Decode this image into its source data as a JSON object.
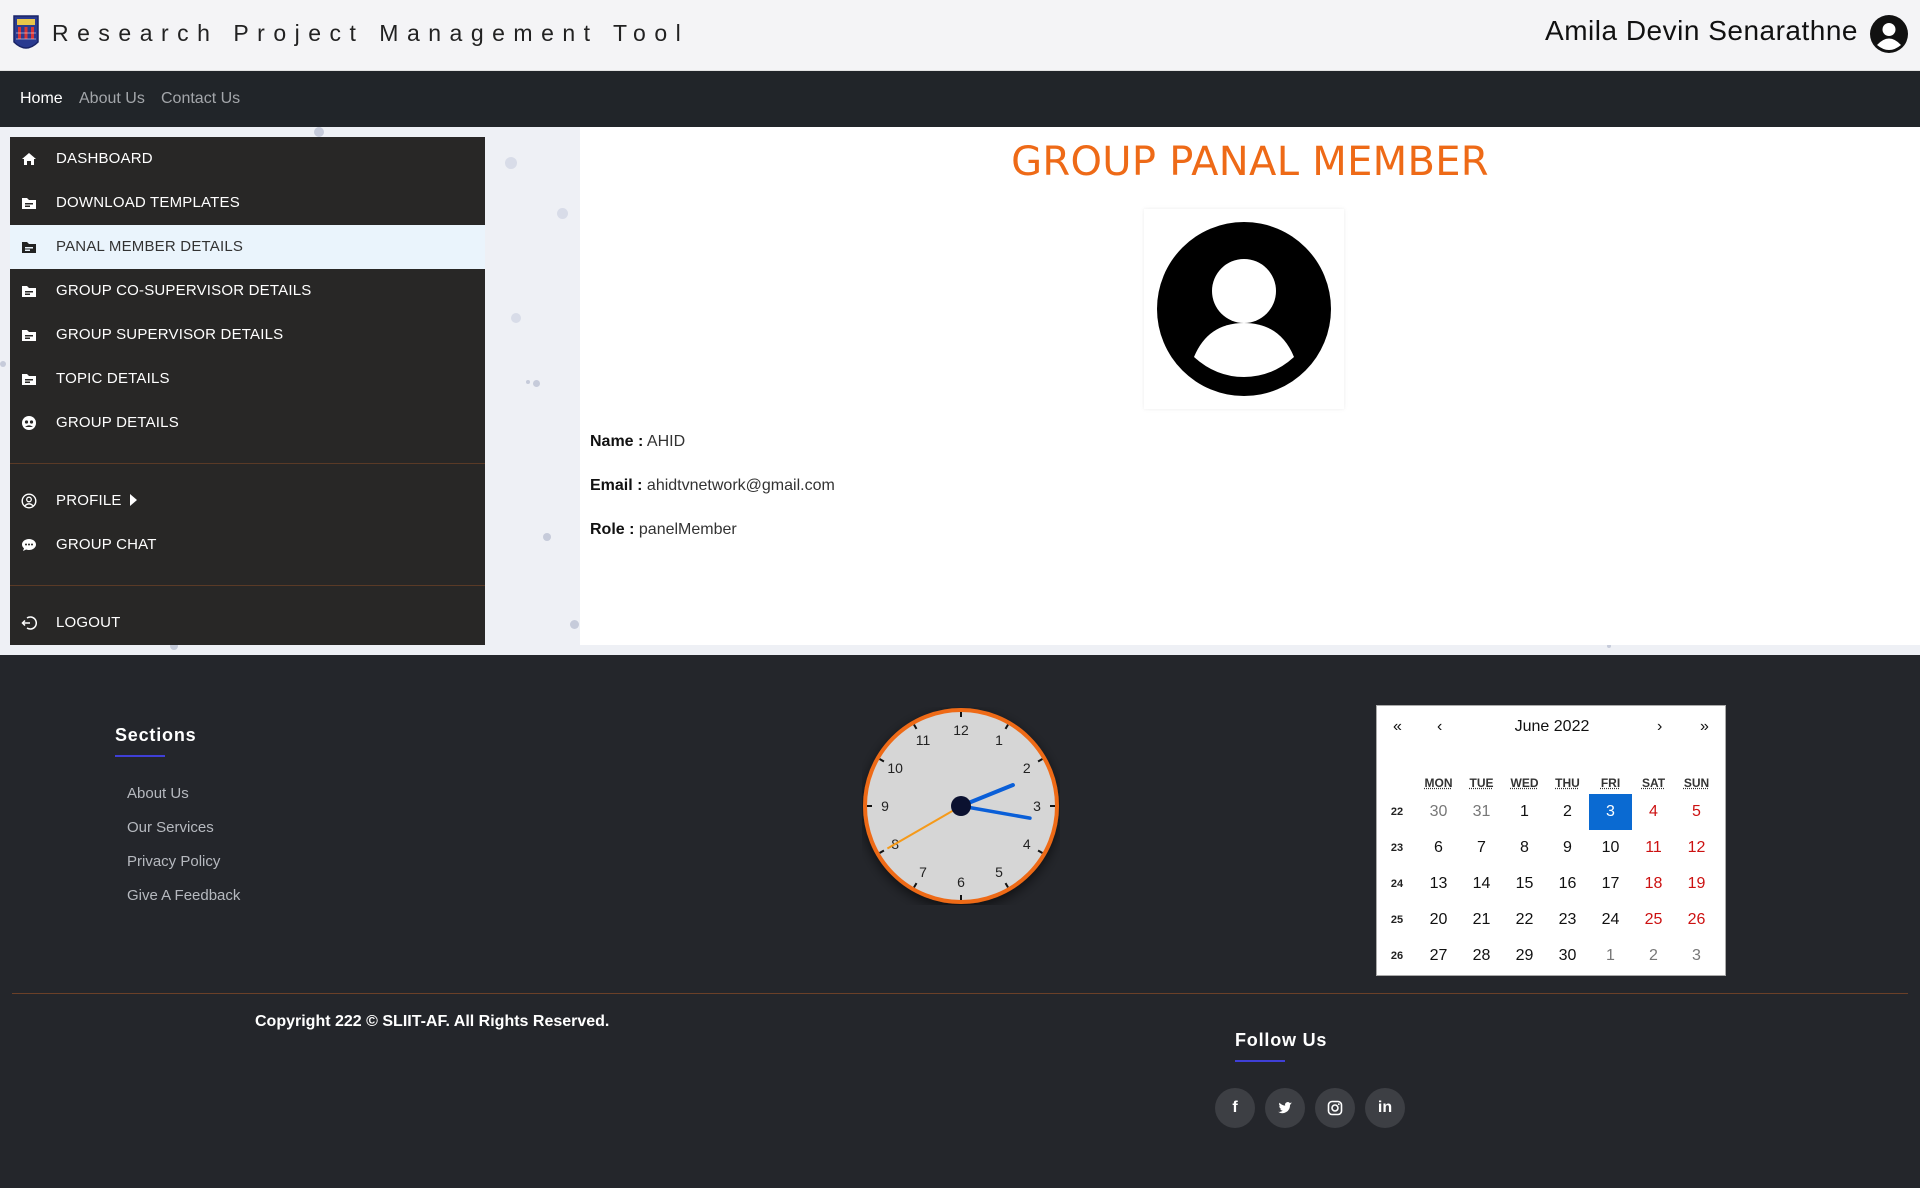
{
  "header": {
    "app_title": "Research Project Management Tool",
    "user_name": "Amila Devin Senarathne"
  },
  "nav": {
    "items": [
      {
        "label": "Home",
        "active": true
      },
      {
        "label": "About Us",
        "active": false
      },
      {
        "label": "Contact Us",
        "active": false
      }
    ]
  },
  "sidebar": {
    "items": [
      {
        "label": "DASHBOARD",
        "icon": "home-icon"
      },
      {
        "label": "DOWNLOAD TEMPLATES",
        "icon": "folder-icon"
      },
      {
        "label": "PANAL MEMBER DETAILS",
        "icon": "folder-icon",
        "active": true
      },
      {
        "label": "GROUP CO-SUPERVISOR DETAILS",
        "icon": "folder-icon"
      },
      {
        "label": "GROUP SUPERVISOR DETAILS",
        "icon": "folder-icon"
      },
      {
        "label": "TOPIC DETAILS",
        "icon": "folder-icon"
      },
      {
        "label": "GROUP DETAILS",
        "icon": "group-icon"
      },
      {
        "label": "PROFILE",
        "icon": "user-circle-icon"
      },
      {
        "label": "GROUP CHAT",
        "icon": "chat-icon"
      },
      {
        "label": "LOGOUT",
        "icon": "logout-icon"
      }
    ]
  },
  "main": {
    "title": "GROUP PANAL MEMBER",
    "fields": [
      {
        "label": "Name :",
        "value": "AHID"
      },
      {
        "label": "Email :",
        "value": "ahidtvnetwork@gmail.com"
      },
      {
        "label": "Role :",
        "value": "panelMember"
      }
    ]
  },
  "footer": {
    "sections_heading": "Sections",
    "links": [
      "About Us",
      "Our Services",
      "Privacy Policy",
      "Give A Feedback"
    ],
    "copyright": "Copyright 222 © SLIIT-AF. All Rights Reserved.",
    "follow_heading": "Follow Us",
    "social": [
      {
        "icon": "facebook-icon",
        "glyph": "f"
      },
      {
        "icon": "twitter-icon",
        "glyph": "🐦"
      },
      {
        "icon": "instagram-icon",
        "glyph": "◎"
      },
      {
        "icon": "linkedin-icon",
        "glyph": "in"
      }
    ]
  },
  "clock": {
    "numbers": [
      "12",
      "1",
      "2",
      "3",
      "4",
      "5",
      "6",
      "7",
      "8",
      "9",
      "10",
      "11"
    ],
    "hour": 2,
    "minute": 16,
    "second": 40,
    "colors": {
      "ring": "#ee6a17",
      "hands": "#0a5fd8",
      "second": "#f59a1a"
    }
  },
  "calendar": {
    "month_label": "June 2022",
    "nav": {
      "prev_year": "«",
      "prev": "‹",
      "next": "›",
      "next_year": "»"
    },
    "weekdays": [
      "MON",
      "TUE",
      "WED",
      "THU",
      "FRI",
      "SAT",
      "SUN"
    ],
    "weeks": [
      {
        "wk": "22",
        "days": [
          "30",
          "31",
          "1",
          "2",
          "3",
          "4",
          "5"
        ],
        "other": [
          true,
          true,
          false,
          false,
          false,
          false,
          false
        ]
      },
      {
        "wk": "23",
        "days": [
          "6",
          "7",
          "8",
          "9",
          "10",
          "11",
          "12"
        ],
        "other": [
          false,
          false,
          false,
          false,
          false,
          false,
          false
        ]
      },
      {
        "wk": "24",
        "days": [
          "13",
          "14",
          "15",
          "16",
          "17",
          "18",
          "19"
        ],
        "other": [
          false,
          false,
          false,
          false,
          false,
          false,
          false
        ]
      },
      {
        "wk": "25",
        "days": [
          "20",
          "21",
          "22",
          "23",
          "24",
          "25",
          "26"
        ],
        "other": [
          false,
          false,
          false,
          false,
          false,
          false,
          false
        ]
      },
      {
        "wk": "26",
        "days": [
          "27",
          "28",
          "29",
          "30",
          "1",
          "2",
          "3"
        ],
        "other": [
          false,
          false,
          false,
          false,
          true,
          true,
          true
        ]
      }
    ],
    "selected": "3"
  },
  "colors": {
    "accent": "#ee6a17",
    "active_day": "#0a6ad2",
    "sidebar_bg": "#282726",
    "footer_bg": "#24262b"
  }
}
